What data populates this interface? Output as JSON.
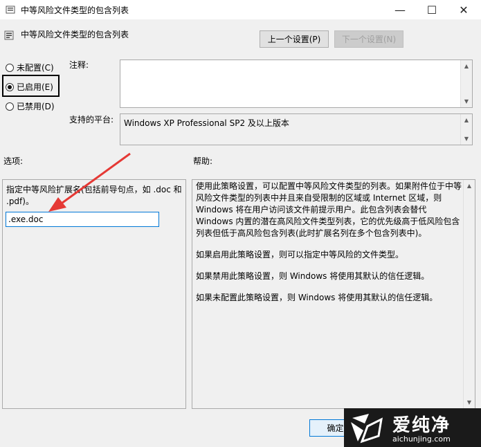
{
  "window": {
    "title": "中等风险文件类型的包含列表",
    "controls": {
      "minimize": "—",
      "maximize": "☐",
      "close": "✕"
    }
  },
  "header": {
    "title": "中等风险文件类型的包含列表"
  },
  "nav": {
    "prev_label": "上一个设置(P)",
    "next_label": "下一个设置(N)"
  },
  "state": {
    "options": [
      {
        "label": "未配置(C)",
        "checked": false
      },
      {
        "label": "已启用(E)",
        "checked": true
      },
      {
        "label": "已禁用(D)",
        "checked": false
      }
    ]
  },
  "comment": {
    "label": "注释:",
    "value": ""
  },
  "platform": {
    "label": "支持的平台:",
    "value": "Windows XP Professional SP2 及以上版本"
  },
  "options_pane": {
    "label": "选项:",
    "description": "指定中等风险扩展名(包括前导句点，如 .doc 和 .pdf)。",
    "input_value": ".exe.doc"
  },
  "help_pane": {
    "label": "帮助:",
    "paragraphs": [
      "使用此策略设置，可以配置中等风险文件类型的列表。如果附件位于中等风险文件类型的列表中并且来自受限制的区域或 Internet 区域，则 Windows 将在用户访问该文件前提示用户。此包含列表会替代 Windows 内置的潜在高风险文件类型列表，它的优先级高于低风险包含列表但低于高风险包含列表(此时扩展名列在多个包含列表中)。",
      "如果启用此策略设置，则可以指定中等风险的文件类型。",
      "如果禁用此策略设置，则 Windows 将使用其默认的信任逻辑。",
      "如果未配置此策略设置，则 Windows 将使用其默认的信任逻辑。"
    ]
  },
  "footer": {
    "ok_label": "确定"
  },
  "watermark": {
    "brand": "爱纯净",
    "url": "aichunjing.com"
  },
  "colors": {
    "arrow": "#e53935",
    "accent": "#0078d7"
  }
}
